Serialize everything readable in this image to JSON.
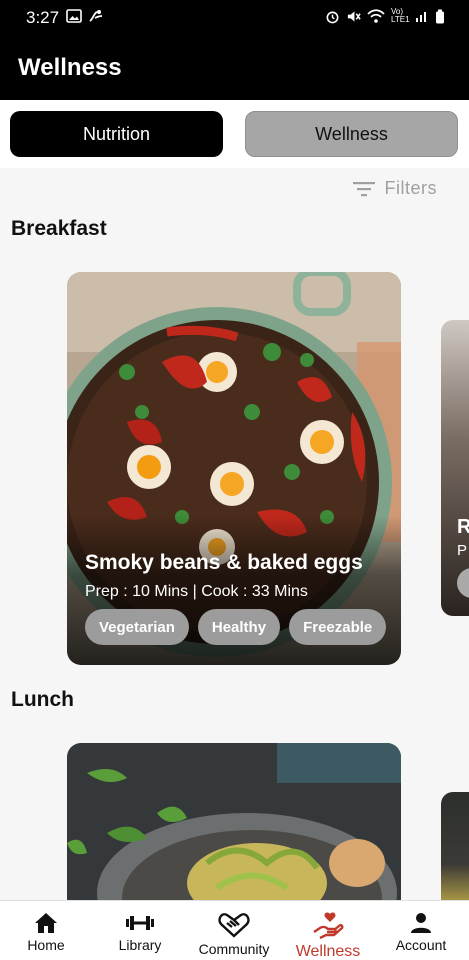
{
  "status_bar": {
    "time": "3:27",
    "network": "Vo) LTE1"
  },
  "app_bar": {
    "title": "Wellness"
  },
  "tabs": [
    {
      "label": "Nutrition",
      "active": true
    },
    {
      "label": "Wellness",
      "active": false
    }
  ],
  "filters": {
    "label": "Filters",
    "icon": "filter-icon"
  },
  "sections": {
    "breakfast": {
      "title": "Breakfast",
      "card": {
        "title": "Smoky beans & baked eggs",
        "meta": "Prep : 10 Mins  | Cook :  33 Mins",
        "tags": [
          "Vegetarian",
          "Healthy",
          "Freezable"
        ]
      },
      "peek": {
        "letter": "R",
        "sub": "P"
      }
    },
    "lunch": {
      "title": "Lunch"
    }
  },
  "bottom_nav": [
    {
      "label": "Home",
      "icon": "home-icon",
      "active": false
    },
    {
      "label": "Library",
      "icon": "dumbbell-icon",
      "active": false
    },
    {
      "label": "Community",
      "icon": "handshake-icon",
      "active": false
    },
    {
      "label": "Wellness",
      "icon": "heart-hand-icon",
      "active": true
    },
    {
      "label": "Account",
      "icon": "person-icon",
      "active": false
    }
  ],
  "colors": {
    "accent": "#c0392b",
    "app_bar": "#000000",
    "tag": "#9c9c9c"
  }
}
